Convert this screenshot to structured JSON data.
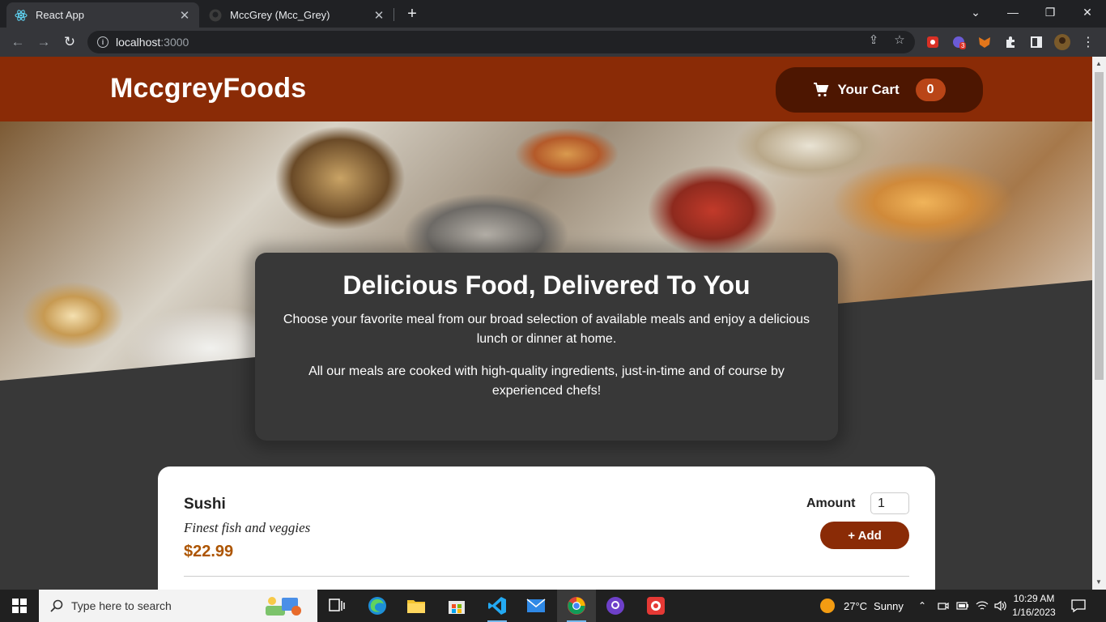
{
  "browser": {
    "tabs": [
      {
        "title": "React App",
        "favicon": "react-icon",
        "active": true
      },
      {
        "title": "MccGrey (Mcc_Grey)",
        "favicon": "github-icon",
        "active": false
      }
    ],
    "url_host": "localhost",
    "url_port": ":3000",
    "extension_badge": "3"
  },
  "app": {
    "brand": "MccgreyFoods",
    "cart": {
      "label": "Your Cart",
      "count": "0"
    }
  },
  "summary": {
    "heading": "Delicious Food, Delivered To You",
    "paragraph1": "Choose your favorite meal from our broad selection of available meals and enjoy a delicious lunch or dinner at home.",
    "paragraph2": "All our meals are cooked with high-quality ingredients, just-in-time and of course by experienced chefs!"
  },
  "meals": [
    {
      "name": "Sushi",
      "description": "Finest fish and veggies",
      "price": "$22.99",
      "amount_label": "Amount",
      "amount_value": "1",
      "add_label": "+ Add"
    }
  ],
  "taskbar": {
    "search_placeholder": "Type here to search",
    "weather": {
      "temp": "27°C",
      "condition": "Sunny"
    },
    "time": "10:29 AM",
    "date": "1/16/2023"
  },
  "colors": {
    "header": "#8a2b06",
    "cart_button": "#4d1601",
    "badge": "#b94517",
    "price": "#ad5502",
    "page_bg": "#383838"
  }
}
